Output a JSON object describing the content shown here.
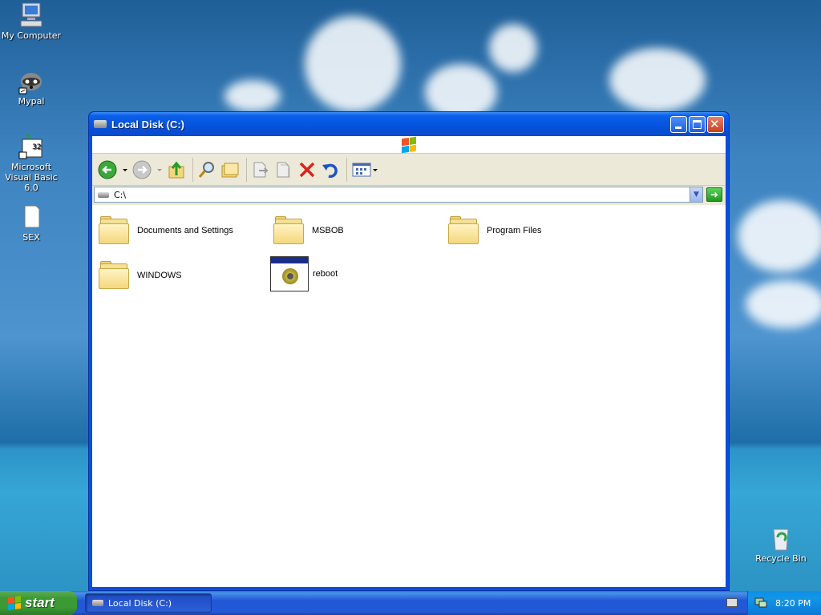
{
  "desktop": {
    "icons": [
      {
        "label": "My Computer"
      },
      {
        "label": "Mypal"
      },
      {
        "label": "Microsoft Visual Basic 6.0"
      },
      {
        "label": "SEX"
      },
      {
        "label": "Recycle Bin"
      }
    ]
  },
  "window": {
    "title": "Local Disk (C:)",
    "address": "C:\\",
    "items": [
      {
        "label": "Documents and Settings",
        "type": "folder"
      },
      {
        "label": "MSBOB",
        "type": "folder"
      },
      {
        "label": "Program Files",
        "type": "folder"
      },
      {
        "label": "WINDOWS",
        "type": "folder"
      },
      {
        "label": "reboot",
        "type": "application"
      }
    ]
  },
  "taskbar": {
    "start_label": "start",
    "tasks": [
      {
        "label": "Local Disk (C:)"
      }
    ],
    "clock": "8:20 PM"
  }
}
